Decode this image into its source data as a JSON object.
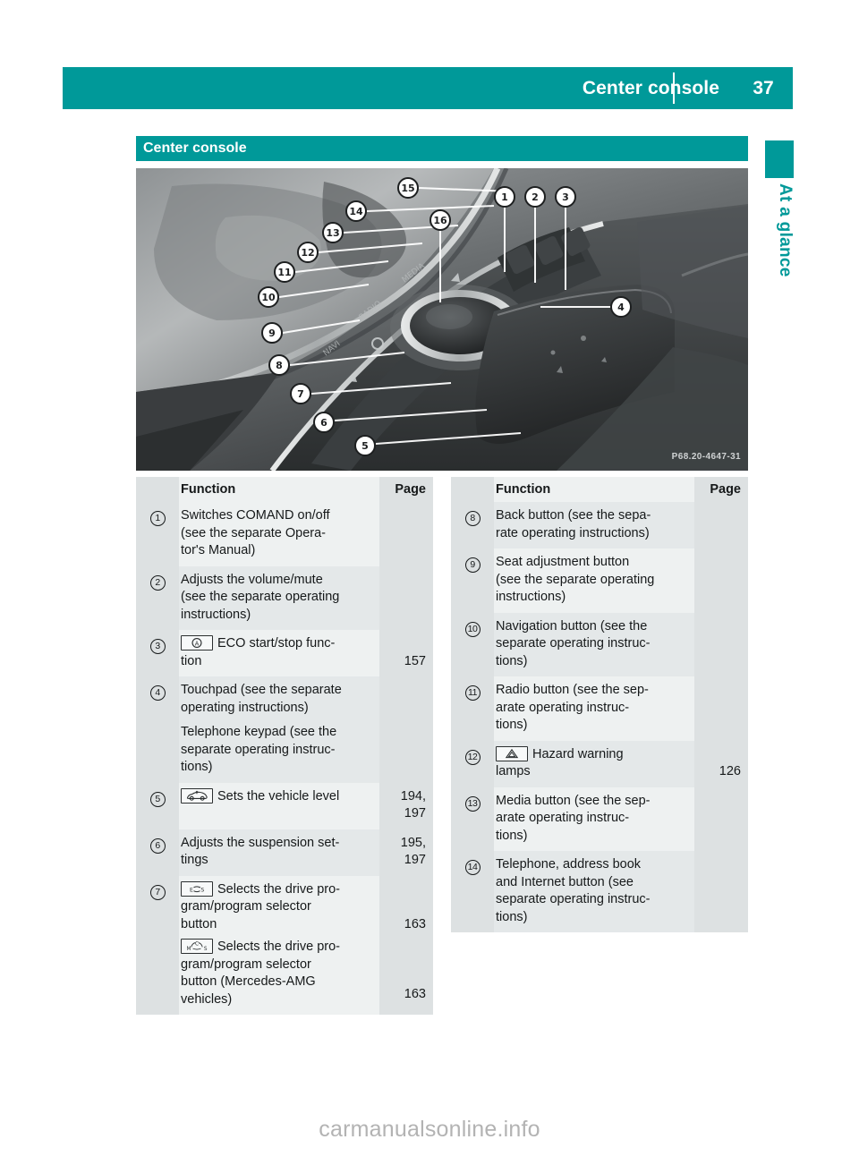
{
  "running_header": {
    "title": "Center console",
    "page_number": "37"
  },
  "side_tab": {
    "label": "At a glance",
    "color": "#009999"
  },
  "section": {
    "heading": "Center console"
  },
  "figure": {
    "photo_code": "P68.20-4647-31",
    "callouts": [
      "1",
      "2",
      "3",
      "4",
      "5",
      "6",
      "7",
      "8",
      "9",
      "10",
      "11",
      "12",
      "13",
      "14",
      "15",
      "16"
    ]
  },
  "tables": {
    "headers": {
      "num": "",
      "function": "Function",
      "page": "Page"
    },
    "left_rows": [
      {
        "marker": "1",
        "icon": null,
        "lines": [
          "Switches COMAND on/off",
          "(see the separate Opera-",
          "tor's Manual)"
        ],
        "pages": []
      },
      {
        "marker": "2",
        "icon": null,
        "lines": [
          "Adjusts the volume/mute",
          "(see the separate operating",
          "instructions)"
        ],
        "pages": []
      },
      {
        "marker": "3",
        "icon": "eco-start-stop-icon",
        "lines": [
          "ECO start/stop func-",
          "tion"
        ],
        "pages": [
          "",
          "157"
        ]
      },
      {
        "marker": "4",
        "icon": null,
        "lines": [
          "Touchpad (see the separate",
          "operating instructions)",
          "Telephone keypad (see the",
          "separate operating instruc-",
          "tions)"
        ],
        "pages": []
      },
      {
        "marker": "5",
        "icon": "vehicle-level-icon",
        "lines": [
          "Sets the vehicle level"
        ],
        "pages": [
          "194,",
          "197"
        ]
      },
      {
        "marker": "6",
        "icon": null,
        "lines": [
          "Adjusts the suspension set-",
          "tings"
        ],
        "pages": [
          "195,",
          "197"
        ]
      },
      {
        "marker": "7",
        "icon": "drive-program-es-icon",
        "lines": [
          "Selects the drive pro-",
          "gram/program selector",
          "button"
        ],
        "icon2": "drive-program-mcs-icon",
        "lines2": [
          "Selects the drive pro-",
          "gram/program selector",
          "button (Mercedes-AMG",
          "vehicles)"
        ],
        "pages": [
          "",
          "",
          "163"
        ],
        "pages2": [
          "",
          "",
          "",
          "163"
        ]
      }
    ],
    "right_rows": [
      {
        "marker": "8",
        "icon": null,
        "lines": [
          "Back button (see the sepa-",
          "rate operating instructions)"
        ],
        "pages": []
      },
      {
        "marker": "9",
        "icon": null,
        "lines": [
          "Seat adjustment button",
          "(see the separate operating",
          "instructions)"
        ],
        "pages": []
      },
      {
        "marker": "10",
        "icon": null,
        "lines": [
          "Navigation button (see the",
          "separate operating instruc-",
          "tions)"
        ],
        "pages": []
      },
      {
        "marker": "11",
        "icon": null,
        "lines": [
          "Radio button (see the sep-",
          "arate operating instruc-",
          "tions)"
        ],
        "pages": []
      },
      {
        "marker": "12",
        "icon": "hazard-warning-icon",
        "lines": [
          "Hazard warning",
          "lamps"
        ],
        "pages": [
          "",
          "126"
        ]
      },
      {
        "marker": "13",
        "icon": null,
        "lines": [
          "Media button (see the sep-",
          "arate operating instruc-",
          "tions)"
        ],
        "pages": []
      },
      {
        "marker": "14",
        "icon": null,
        "lines": [
          "Telephone, address book",
          "and Internet button (see",
          "separate operating instruc-",
          "tions)"
        ],
        "pages": []
      }
    ]
  },
  "watermark": "carmanualsonline.info"
}
